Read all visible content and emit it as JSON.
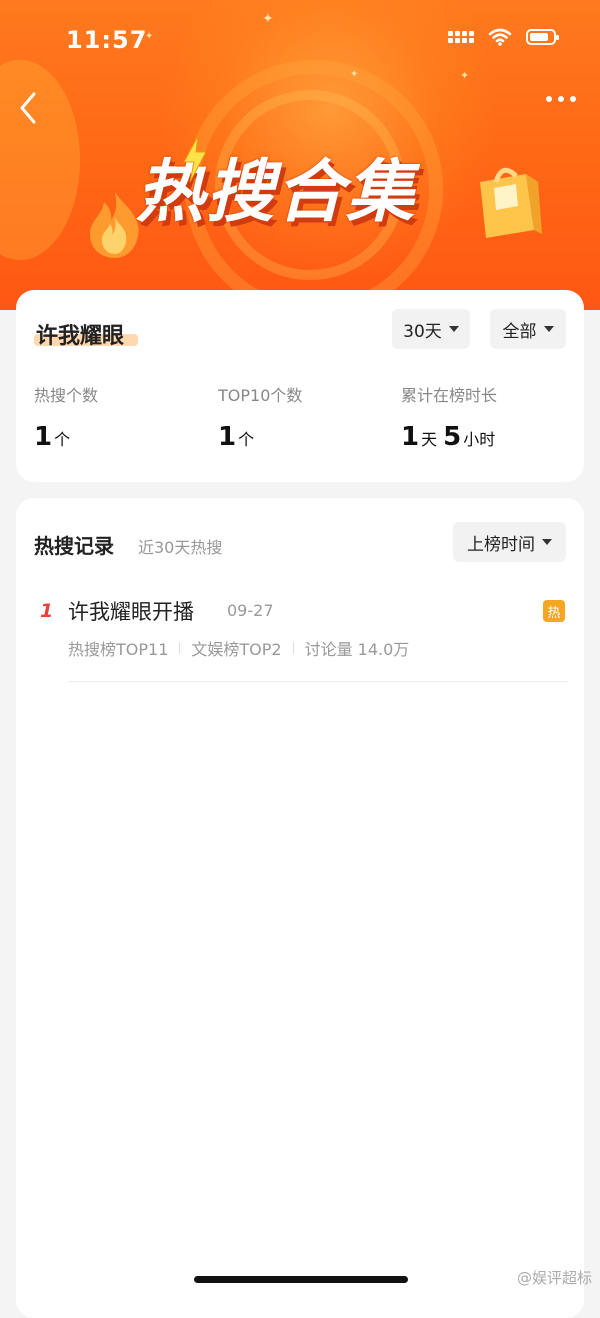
{
  "status_bar": {
    "time": "11:57"
  },
  "header": {
    "title": "热搜合集"
  },
  "summary": {
    "name": "许我耀眼",
    "filters": {
      "days": "30天",
      "scope": "全部"
    },
    "stats": [
      {
        "label": "热搜个数",
        "value": "1",
        "unit": "个"
      },
      {
        "label": "TOP10个数",
        "value": "1",
        "unit": "个"
      },
      {
        "label": "累计在榜时长",
        "days": "1",
        "days_unit": "天",
        "hours": "5",
        "hours_unit": "小时"
      }
    ]
  },
  "records": {
    "title": "热搜记录",
    "subtitle": "近30天热搜",
    "sort_label": "上榜时间",
    "items": [
      {
        "rank": "1",
        "title": "许我耀眼开播",
        "date": "09-27",
        "badge": "热",
        "meta": [
          "热搜榜TOP11",
          "文娱榜TOP2",
          "讨论量 14.0万"
        ]
      }
    ]
  },
  "watermark": "@娱评超标"
}
